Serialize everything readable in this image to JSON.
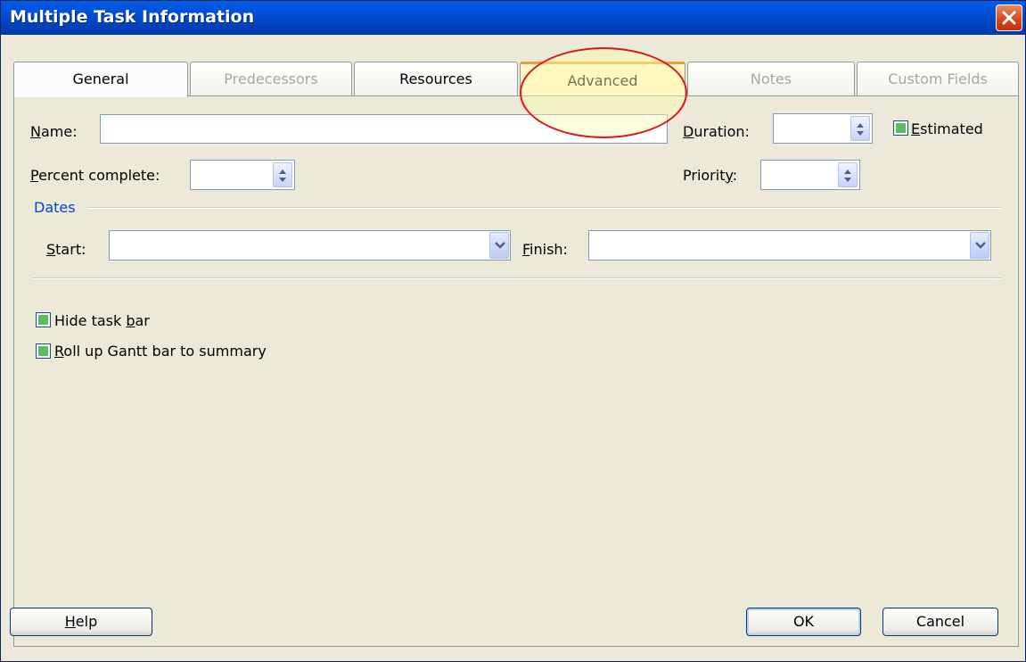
{
  "window": {
    "title": "Multiple Task Information",
    "close_icon": "close-icon"
  },
  "tabs": [
    {
      "label": "General",
      "state": "active"
    },
    {
      "label": "Predecessors",
      "state": "disabled"
    },
    {
      "label": "Resources",
      "state": "normal"
    },
    {
      "label": "Advanced",
      "state": "highlighted"
    },
    {
      "label": "Notes",
      "state": "disabled"
    },
    {
      "label": "Custom Fields",
      "state": "disabled"
    }
  ],
  "general": {
    "name_label": {
      "mnemonic": "N",
      "rest": "ame:"
    },
    "name_value": "",
    "duration_label": {
      "mnemonic": "D",
      "rest": "uration:"
    },
    "duration_value": "",
    "estimated_label": {
      "mnemonic": "E",
      "rest": "stimated"
    },
    "estimated_checked": true,
    "percent_label": {
      "mnemonic": "P",
      "rest": "ercent complete:"
    },
    "percent_value": "",
    "priority_label": {
      "prefix": "Priorit",
      "mnemonic": "y",
      "rest": ":"
    },
    "priority_value": "",
    "dates_group": "Dates",
    "start_label": {
      "mnemonic": "S",
      "rest": "tart:"
    },
    "start_value": "",
    "finish_label": {
      "mnemonic": "F",
      "rest": "inish:"
    },
    "finish_value": "",
    "hide_task_bar": {
      "prefix": "Hide task ",
      "mnemonic": "b",
      "rest": "ar",
      "checked": true
    },
    "rollup": {
      "mnemonic": "R",
      "rest": "oll up Gantt bar to summary",
      "checked": true
    }
  },
  "buttons": {
    "help": {
      "mnemonic": "H",
      "rest": "elp"
    },
    "ok": "OK",
    "cancel": "Cancel"
  },
  "colors": {
    "title_bar": "#0054e3",
    "dialog_bg": "#ece9d8",
    "group_label": "#0046d5",
    "annotation": "#e01818"
  }
}
